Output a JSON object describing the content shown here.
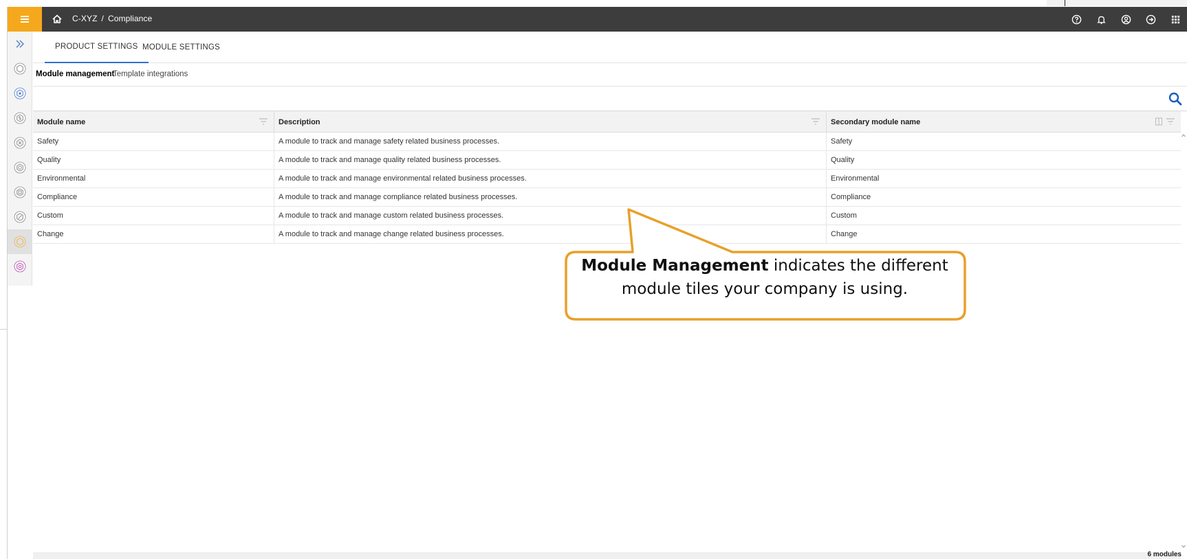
{
  "topbar": {
    "breadcrumb": [
      "C-XYZ",
      "Compliance"
    ],
    "separator": "/",
    "icons": [
      "help-icon",
      "bell-icon",
      "user-icon",
      "logout-icon",
      "apps-grid-icon"
    ]
  },
  "rail": {
    "icons": [
      "expand-icon",
      "module-hex-icon",
      "settings-hex-icon",
      "safety-hex-icon",
      "quality-hex-icon",
      "environmental-hex-icon",
      "compliance-hex-icon",
      "custom-hex-icon",
      "change-hex-icon",
      "template-hex-icon"
    ]
  },
  "tabs": [
    {
      "label": "PRODUCT SETTINGS",
      "active": true
    },
    {
      "label": "MODULE SETTINGS",
      "active": false
    }
  ],
  "subtabs": [
    {
      "label": "Module management",
      "active": true
    },
    {
      "label": "Template integrations",
      "active": false
    }
  ],
  "table": {
    "columns": [
      "Module name",
      "Description",
      "Secondary module name"
    ],
    "rows": [
      [
        "Safety",
        "A module to track and manage safety related business processes.",
        "Safety"
      ],
      [
        "Quality",
        "A module to track and manage quality related business processes.",
        "Quality"
      ],
      [
        "Environmental",
        "A module to track and manage environmental related business processes.",
        "Environmental"
      ],
      [
        "Compliance",
        "A module to track and manage compliance related business processes.",
        "Compliance"
      ],
      [
        "Custom",
        "A module to track and manage custom related business processes.",
        "Custom"
      ],
      [
        "Change",
        "A module to track and manage change related business processes.",
        "Change"
      ]
    ]
  },
  "footer": {
    "count": "6 modules"
  },
  "callout": {
    "bold": "Module Management",
    "line1_rest": " indicates the different",
    "line2": "module tiles your company is using."
  },
  "colors": {
    "accent": "#f5a81c",
    "topbar": "#3d3d3d",
    "tab_underline": "#2f6fcf",
    "search": "#1a5fbf",
    "callout_border": "#e8a02a"
  }
}
